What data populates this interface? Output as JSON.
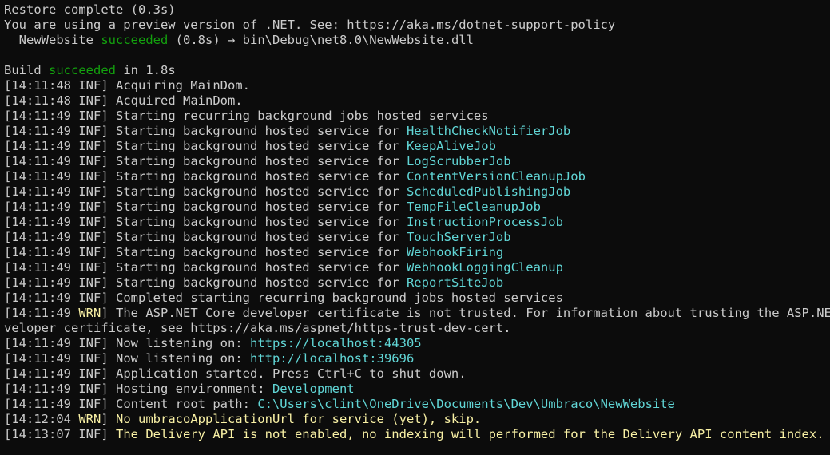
{
  "colors": {
    "background": "#0c0c0c",
    "text": "#cccccc",
    "success": "#13a10e",
    "highlight": "#61d6d6",
    "warning": "#f9f1a5"
  },
  "header": {
    "restore": "Restore complete (0.3s)",
    "preview_notice": "You are using a preview version of .NET. See: https://aka.ms/dotnet-support-policy",
    "project_prefix": "  NewWebsite ",
    "project_status": "succeeded",
    "project_time": " (0.8s) → ",
    "project_output": "bin\\Debug\\net8.0\\NewWebsite.dll",
    "build_prefix": "Build ",
    "build_status": "succeeded",
    "build_time": " in 1.8s"
  },
  "log": [
    {
      "ts": "[14:11:48 ",
      "lvl": "INF",
      "close": "] ",
      "msg": "Acquiring MainDom.",
      "hl": ""
    },
    {
      "ts": "[14:11:48 ",
      "lvl": "INF",
      "close": "] ",
      "msg": "Acquired MainDom.",
      "hl": ""
    },
    {
      "ts": "[14:11:49 ",
      "lvl": "INF",
      "close": "] ",
      "msg": "Starting recurring background jobs hosted services",
      "hl": ""
    },
    {
      "ts": "[14:11:49 ",
      "lvl": "INF",
      "close": "] ",
      "msg": "Starting background hosted service for ",
      "hl": "HealthCheckNotifierJob"
    },
    {
      "ts": "[14:11:49 ",
      "lvl": "INF",
      "close": "] ",
      "msg": "Starting background hosted service for ",
      "hl": "KeepAliveJob"
    },
    {
      "ts": "[14:11:49 ",
      "lvl": "INF",
      "close": "] ",
      "msg": "Starting background hosted service for ",
      "hl": "LogScrubberJob"
    },
    {
      "ts": "[14:11:49 ",
      "lvl": "INF",
      "close": "] ",
      "msg": "Starting background hosted service for ",
      "hl": "ContentVersionCleanupJob"
    },
    {
      "ts": "[14:11:49 ",
      "lvl": "INF",
      "close": "] ",
      "msg": "Starting background hosted service for ",
      "hl": "ScheduledPublishingJob"
    },
    {
      "ts": "[14:11:49 ",
      "lvl": "INF",
      "close": "] ",
      "msg": "Starting background hosted service for ",
      "hl": "TempFileCleanupJob"
    },
    {
      "ts": "[14:11:49 ",
      "lvl": "INF",
      "close": "] ",
      "msg": "Starting background hosted service for ",
      "hl": "InstructionProcessJob"
    },
    {
      "ts": "[14:11:49 ",
      "lvl": "INF",
      "close": "] ",
      "msg": "Starting background hosted service for ",
      "hl": "TouchServerJob"
    },
    {
      "ts": "[14:11:49 ",
      "lvl": "INF",
      "close": "] ",
      "msg": "Starting background hosted service for ",
      "hl": "WebhookFiring"
    },
    {
      "ts": "[14:11:49 ",
      "lvl": "INF",
      "close": "] ",
      "msg": "Starting background hosted service for ",
      "hl": "WebhookLoggingCleanup"
    },
    {
      "ts": "[14:11:49 ",
      "lvl": "INF",
      "close": "] ",
      "msg": "Starting background hosted service for ",
      "hl": "ReportSiteJob"
    },
    {
      "ts": "[14:11:49 ",
      "lvl": "INF",
      "close": "] ",
      "msg": "Completed starting recurring background jobs hosted services",
      "hl": ""
    },
    {
      "ts": "[14:11:49 ",
      "lvl": "WRN",
      "close": "] ",
      "msg": "The ASP.NET Core developer certificate is not trusted. For information about trusting the ASP.NET Co",
      "hl": "",
      "warn": true
    },
    {
      "ts": "",
      "lvl": "",
      "close": "",
      "msg": "veloper certificate, see https://aka.ms/aspnet/https-trust-dev-cert.",
      "hl": "",
      "cont": true
    },
    {
      "ts": "[14:11:49 ",
      "lvl": "INF",
      "close": "] ",
      "msg": "Now listening on: ",
      "hl": "https://localhost:44305"
    },
    {
      "ts": "[14:11:49 ",
      "lvl": "INF",
      "close": "] ",
      "msg": "Now listening on: ",
      "hl": "http://localhost:39696"
    },
    {
      "ts": "[14:11:49 ",
      "lvl": "INF",
      "close": "] ",
      "msg": "Application started. Press Ctrl+C to shut down.",
      "hl": ""
    },
    {
      "ts": "[14:11:49 ",
      "lvl": "INF",
      "close": "] ",
      "msg": "Hosting environment: ",
      "hl": "Development"
    },
    {
      "ts": "[14:11:49 ",
      "lvl": "INF",
      "close": "] ",
      "msg": "Content root path: ",
      "hl": "C:\\Users\\clint\\OneDrive\\Documents\\Dev\\Umbraco\\NewWebsite"
    },
    {
      "ts": "[14:12:04 ",
      "lvl": "WRN",
      "close": "] ",
      "msg": "",
      "hl": "",
      "yellow_msg": "No umbracoApplicationUrl for service (yet), skip.",
      "warn": true
    },
    {
      "ts": "[14:13:07 ",
      "lvl": "INF",
      "close": "] ",
      "msg": "",
      "hl": "",
      "yellow_msg": "The Delivery API is not enabled, no indexing will performed for the Delivery API content index."
    }
  ]
}
